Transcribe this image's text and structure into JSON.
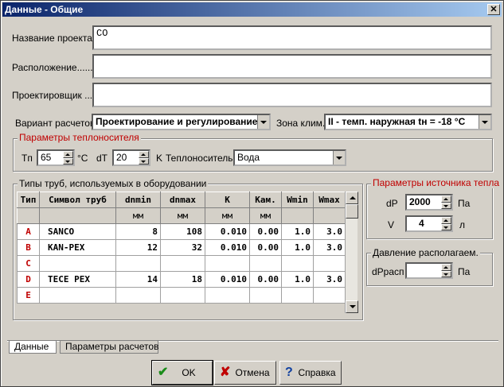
{
  "window": {
    "title": "Данные - Общие",
    "close_label": "✕"
  },
  "project": {
    "name_label": "Название проекта..",
    "name_value": "CO",
    "location_label": "Расположение.........",
    "location_value": "",
    "designer_label": "Проектировщик ....",
    "designer_value": ""
  },
  "calc": {
    "variant_label": "Вариант расчетов",
    "variant_value": "Проектирование и регулирование",
    "zone_label": "Зона клим.",
    "zone_value": "II  - темп. наружная tн = -18 °C"
  },
  "coolant": {
    "group_label": "Параметры теплоносителя",
    "tp_label": "Tп",
    "tp_value": "65",
    "tp_unit": "°C",
    "dt_label": "dT",
    "dt_value": "20",
    "dt_unit": "K",
    "medium_label": "Теплоноситель",
    "medium_value": "Вода"
  },
  "pipes": {
    "group_label": "Типы труб, используемых в оборудовании",
    "headers": [
      "Тип",
      "Символ труб",
      "dnmin",
      "dnmax",
      "K",
      "Кам.",
      "Wmin",
      "Wmax"
    ],
    "units": [
      "",
      "",
      "мм",
      "мм",
      "мм",
      "мм",
      "",
      ""
    ],
    "rows": [
      {
        "key": "A",
        "name": "SANCO",
        "dnmin": "8",
        "dnmax": "108",
        "k": "0.010",
        "kam": "0.00",
        "wmin": "1.0",
        "wmax": "3.0"
      },
      {
        "key": "B",
        "name": "KAN-PEX",
        "dnmin": "12",
        "dnmax": "32",
        "k": "0.010",
        "kam": "0.00",
        "wmin": "1.0",
        "wmax": "3.0"
      },
      {
        "key": "C",
        "name": "",
        "dnmin": "",
        "dnmax": "",
        "k": "",
        "kam": "",
        "wmin": "",
        "wmax": ""
      },
      {
        "key": "D",
        "name": "TECE PEX",
        "dnmin": "14",
        "dnmax": "18",
        "k": "0.010",
        "kam": "0.00",
        "wmin": "1.0",
        "wmax": "3.0"
      },
      {
        "key": "E",
        "name": "",
        "dnmin": "",
        "dnmax": "",
        "k": "",
        "kam": "",
        "wmin": "",
        "wmax": ""
      }
    ]
  },
  "source": {
    "group_label": "Параметры источника тепла",
    "dp_label": "dP",
    "dp_value": "2000",
    "dp_unit": "Па",
    "v_label": "V",
    "v_value": "4",
    "v_unit": "л"
  },
  "available": {
    "group_label": "Давление располагаем.",
    "dprasp_label": "dPрасп",
    "dprasp_value": "",
    "dprasp_unit": "Па"
  },
  "tabs": [
    "Данные",
    "Параметры расчетов"
  ],
  "buttons": {
    "ok": "OK",
    "cancel": "Отмена",
    "help": "Справка"
  },
  "colors": {
    "accent_red": "#c00000",
    "title_start": "#0a246a",
    "title_end": "#a6caf0"
  }
}
